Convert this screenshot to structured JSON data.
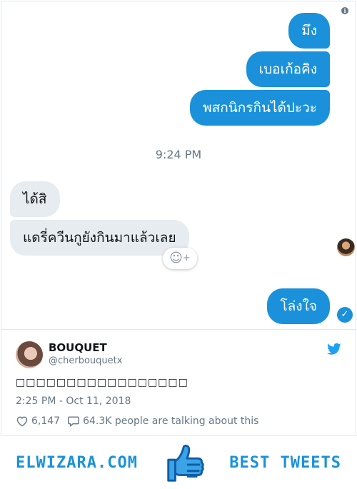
{
  "messages": {
    "m1": "มึง",
    "m2": "เบอเก้อคิง",
    "m3": "พสกนิกรกินได้ปะวะ",
    "time": "9:24 PM",
    "m4": "ได้สิ",
    "m5": "แดรี่ควีนกูยังกินมาแล้วเลย",
    "m6": "โล่งใจ"
  },
  "tweet": {
    "name": "BOUQUET",
    "handle": "@cherbouquetx",
    "text": "□□□□□□□□□□□□□□□□□",
    "datetime": "2:25 PM - Oct 11, 2018",
    "likes": "6,147",
    "talking": "64.3K people are talking about this"
  },
  "banner": {
    "left": "ELWIZARA.COM",
    "right": "BEST TWEETS"
  },
  "icons": {
    "info": "info-icon",
    "react": "add-reaction-icon",
    "read": "read-check-icon",
    "bird": "twitter-bird-icon",
    "heart": "heart-icon",
    "reply": "reply-bubble-icon",
    "thumb": "thumbs-up-icon"
  },
  "colors": {
    "accent": "#1a91da",
    "incoming": "#e6ecf0"
  }
}
